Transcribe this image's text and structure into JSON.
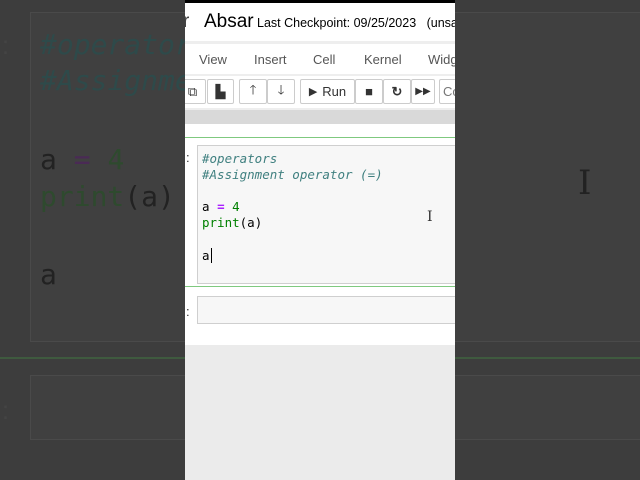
{
  "notebook": {
    "title": "Absar",
    "checkpoint": "Last Checkpoint: 09/25/2023",
    "unsaved": "(unsa",
    "lead_glyph": "r"
  },
  "menu": [
    "View",
    "Insert",
    "Cell",
    "Kernel",
    "Widg"
  ],
  "toolbar": {
    "run_label": "Run",
    "cell_type": "Co"
  },
  "cell": {
    "prompt": ":",
    "lines": [
      "#operators",
      "#Assignment operator (=)",
      "a",
      "=",
      "4",
      "print",
      "(a)",
      "a"
    ]
  },
  "empty_cell": {
    "prompt": ":"
  },
  "background": {
    "lines": [
      "#operator",
      "#Assignme",
      "a",
      "=",
      "4",
      "print",
      "(a)",
      "a"
    ],
    "prompt": ":"
  }
}
